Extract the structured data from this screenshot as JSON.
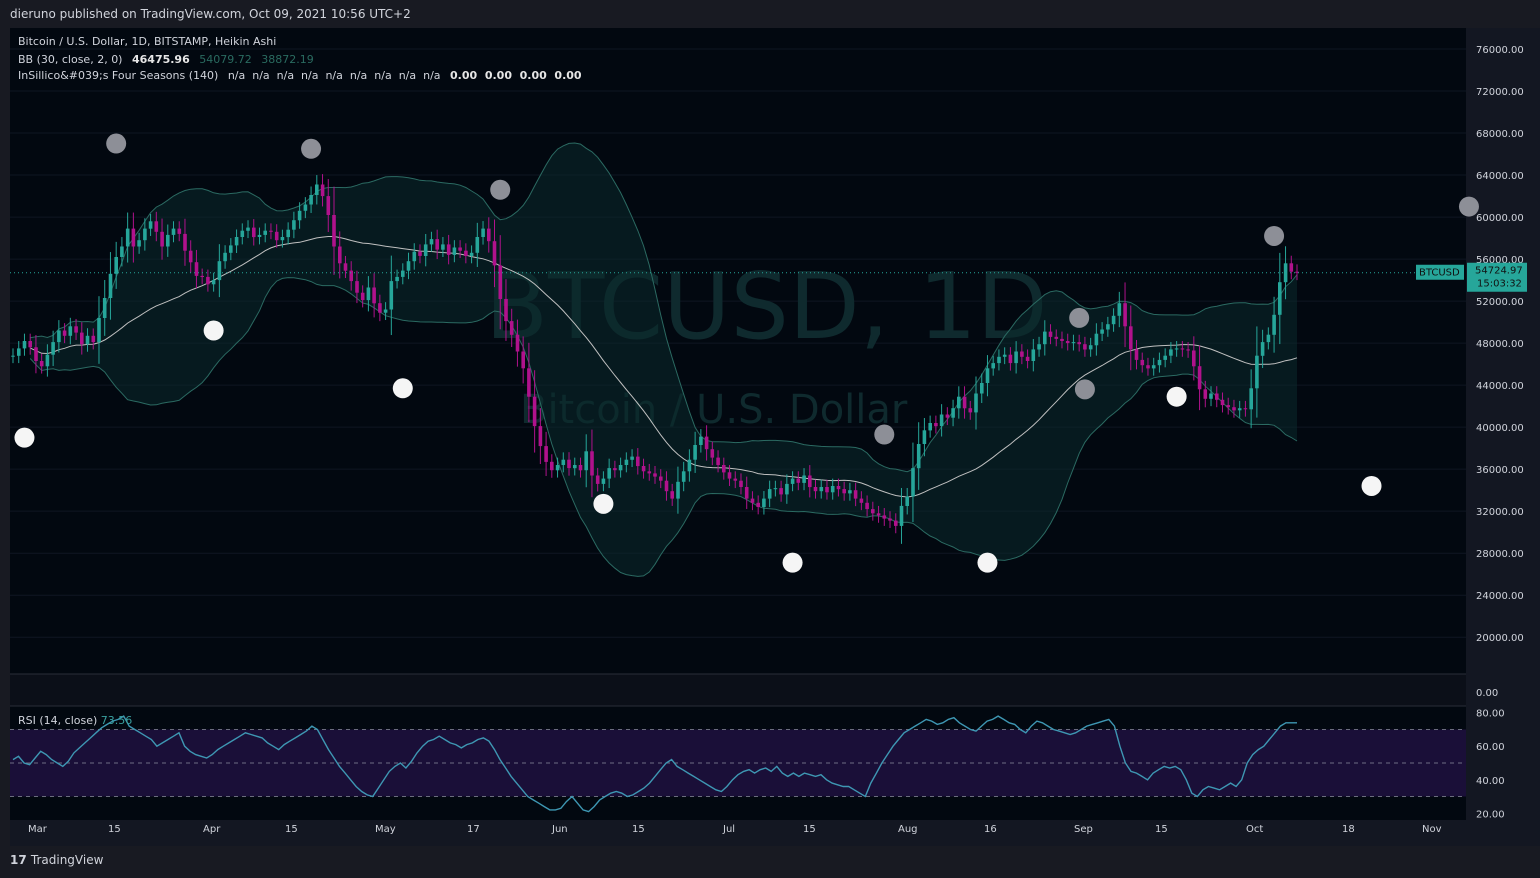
{
  "header": {
    "published": "dieruno published on TradingView.com, Oct 09, 2021 10:56 UTC+2"
  },
  "legend": {
    "title": "Bitcoin / U.S. Dollar, 1D, BITSTAMP, Heikin Ashi",
    "bb_label": "BB (30, close, 2, 0)",
    "bb_basis": "46475.96",
    "bb_upper": "54079.72",
    "bb_lower": "38872.19",
    "fs_label": "InSillico&#039;s Four Seasons (140)",
    "fs_na": "n/a  n/a  n/a  n/a  n/a  n/a  n/a  n/a  n/a",
    "fs_vals": "0.00  0.00  0.00  0.00"
  },
  "watermark": {
    "symbol": "BTCUSD, 1D",
    "name": "Bitcoin / U.S. Dollar"
  },
  "price_tag": {
    "symbol": "BTCUSD",
    "price": "54724.97",
    "countdown": "15:03:32"
  },
  "rsi": {
    "label": "RSI (14, close)",
    "value": "73.56"
  },
  "footer": {
    "logo": "TradingView"
  },
  "colors": {
    "bg": "#020810",
    "up": "#26a69a",
    "down": "#b0128c",
    "bb": "#2b6a62",
    "basis": "#c0c0c0",
    "rsi": "#3e97b3",
    "rsi_band": "#1a0f38"
  },
  "chart_data": [
    {
      "type": "candlestick",
      "title": "Bitcoin / U.S. Dollar, 1D, BITSTAMP, Heikin Ashi",
      "x_ticks": [
        "Mar",
        "15",
        "Apr",
        "15",
        "May",
        "17",
        "Jun",
        "15",
        "Jul",
        "15",
        "Aug",
        "16",
        "Sep",
        "15",
        "Oct",
        "18",
        "Nov"
      ],
      "y_ticks": [
        76000,
        72000,
        68000,
        64000,
        60000,
        56000,
        52000,
        48000,
        44000,
        40000,
        36000,
        32000,
        28000,
        24000,
        20000
      ],
      "ylim": [
        16500,
        78000
      ],
      "close_series": [
        46800,
        47500,
        48200,
        47600,
        46300,
        45800,
        46900,
        48100,
        49200,
        48700,
        49600,
        49000,
        47900,
        48700,
        48100,
        50400,
        52300,
        54600,
        56200,
        57200,
        58900,
        57200,
        57800,
        58900,
        59600,
        58600,
        57200,
        58300,
        58900,
        58400,
        56800,
        55700,
        54400,
        54300,
        53600,
        54000,
        55800,
        56600,
        57300,
        58100,
        58700,
        59000,
        58100,
        58300,
        58700,
        58600,
        57800,
        58100,
        58800,
        59700,
        60600,
        61200,
        62100,
        63100,
        62000,
        60200,
        57200,
        55600,
        54900,
        53900,
        52800,
        52100,
        53300,
        51800,
        50900,
        51200,
        53900,
        54300,
        54900,
        55800,
        56700,
        56300,
        57400,
        57900,
        56900,
        57400,
        56400,
        57100,
        56800,
        56300,
        56600,
        58100,
        58900,
        57700,
        55400,
        52200,
        50100,
        48800,
        47200,
        45600,
        42900,
        40100,
        38200,
        36700,
        35900,
        36400,
        36900,
        36100,
        36400,
        35900,
        37700,
        35400,
        34600,
        35100,
        36100,
        35900,
        36400,
        36900,
        37200,
        36300,
        35800,
        35600,
        35300,
        34900,
        33900,
        33200,
        34800,
        35800,
        36900,
        38300,
        39100,
        37900,
        37100,
        36400,
        35700,
        35100,
        34900,
        34300,
        33200,
        32800,
        32400,
        33200,
        34100,
        34200,
        33600,
        34600,
        35100,
        34700,
        35400,
        34300,
        33900,
        34300,
        33800,
        34400,
        34100,
        33700,
        34000,
        33200,
        32800,
        32200,
        31800,
        31600,
        31300,
        31100,
        30600,
        32500,
        33400,
        36100,
        38400,
        39700,
        40400,
        40100,
        41200,
        40900,
        41800,
        42900,
        41800,
        41400,
        43200,
        44200,
        45600,
        46100,
        46700,
        46900,
        46100,
        47200,
        46700,
        46300,
        47400,
        47900,
        49100,
        48600,
        48400,
        48200,
        48000,
        48100,
        47900,
        47400,
        47800,
        48900,
        49300,
        49800,
        50600,
        51800,
        49600,
        47400,
        46400,
        45900,
        45600,
        45900,
        46400,
        46800,
        47400,
        47500,
        47400,
        47300,
        45800,
        43600,
        42700,
        43200,
        42600,
        42100,
        41900,
        41600,
        41800,
        41700,
        43700,
        46800,
        48100,
        48800,
        50700,
        53800,
        55600,
        54800,
        54700
      ],
      "bb_period": 30,
      "bb_mult": 2,
      "season_dots": {
        "gray_prices": [
          67000,
          66500,
          62600,
          43600,
          39300,
          50400,
          58200,
          61000
        ],
        "white_prices": [
          39000,
          49200,
          43700,
          32700,
          27100,
          27100,
          42900,
          34400
        ]
      }
    },
    {
      "type": "line",
      "title": "RSI (14, close)",
      "y_ticks": [
        80,
        60,
        40,
        20
      ],
      "bands": [
        30,
        50,
        70
      ],
      "ylim": [
        16,
        84
      ],
      "values": [
        52,
        54,
        50,
        49,
        53,
        57,
        55,
        52,
        50,
        48,
        51,
        56,
        59,
        62,
        65,
        68,
        71,
        73,
        75,
        76,
        78,
        72,
        70,
        68,
        66,
        64,
        60,
        62,
        64,
        66,
        68,
        60,
        57,
        55,
        54,
        53,
        55,
        58,
        60,
        62,
        64,
        66,
        68,
        67,
        66,
        65,
        62,
        60,
        58,
        61,
        63,
        65,
        67,
        69,
        72,
        70,
        64,
        58,
        53,
        48,
        44,
        40,
        36,
        33,
        31,
        30,
        35,
        40,
        45,
        48,
        50,
        47,
        51,
        56,
        60,
        63,
        64,
        66,
        64,
        62,
        61,
        59,
        61,
        62,
        64,
        65,
        63,
        58,
        52,
        47,
        42,
        38,
        34,
        30,
        28,
        26,
        24,
        22,
        22,
        23,
        27,
        30,
        26,
        22,
        21,
        24,
        28,
        30,
        32,
        33,
        32,
        30,
        31,
        33,
        35,
        38,
        42,
        46,
        50,
        52,
        48,
        46,
        44,
        42,
        40,
        38,
        36,
        34,
        33,
        36,
        40,
        43,
        45,
        46,
        44,
        46,
        47,
        45,
        48,
        44,
        42,
        44,
        42,
        44,
        43,
        42,
        43,
        40,
        38,
        37,
        36,
        36,
        34,
        32,
        30,
        38,
        44,
        50,
        55,
        60,
        64,
        68,
        70,
        72,
        74,
        76,
        75,
        73,
        74,
        76,
        77,
        74,
        72,
        70,
        69,
        72,
        75,
        76,
        78,
        76,
        74,
        73,
        70,
        68,
        72,
        75,
        74,
        72,
        70,
        69,
        68,
        67,
        68,
        70,
        72,
        73,
        74,
        75,
        76,
        72,
        60,
        50,
        45,
        44,
        42,
        40,
        44,
        46,
        48,
        47,
        48,
        46,
        40,
        32,
        30,
        34,
        36,
        35,
        34,
        36,
        38,
        36,
        40,
        50,
        55,
        58,
        60,
        64,
        68,
        72,
        74,
        74,
        74
      ]
    }
  ]
}
